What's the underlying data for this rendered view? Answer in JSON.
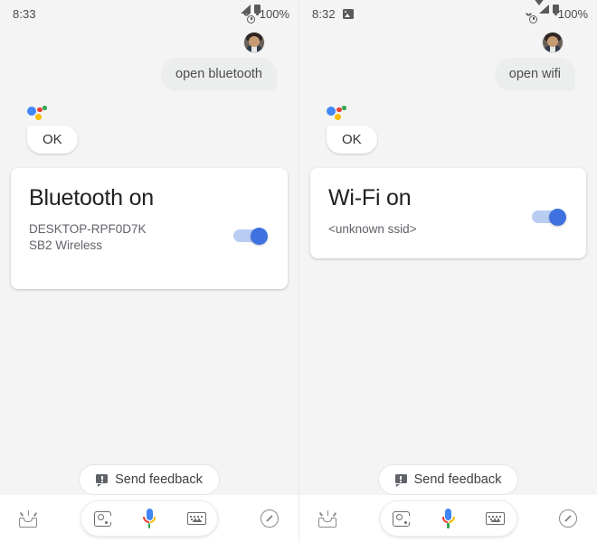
{
  "panels": [
    {
      "status": {
        "time": "8:33",
        "left_icons": [],
        "right_icons": [
          "alarm-icon",
          "signal-icon",
          "battery-icon"
        ],
        "battery_percent": "100%"
      },
      "user_message": "open bluetooth",
      "assistant_reply": "OK",
      "card": {
        "title": "Bluetooth on",
        "subtitle_line1": "DESKTOP-RPF0D7K",
        "subtitle_line2": "SB2 Wireless",
        "toggle_state": "on"
      },
      "feedback_label": "Send feedback",
      "navbar": {
        "snapshot": "snapshot-icon",
        "lens": "lens-icon",
        "mic": "mic-icon",
        "keyboard": "keyboard-icon",
        "explore": "compass-icon"
      }
    },
    {
      "status": {
        "time": "8:32",
        "left_icons": [
          "image-icon"
        ],
        "right_icons": [
          "alarm-icon",
          "wifi-icon",
          "signal-icon",
          "battery-icon"
        ],
        "battery_percent": "100%"
      },
      "user_message": "open wifi",
      "assistant_reply": "OK",
      "card": {
        "title": "Wi-Fi on",
        "subtitle_line1": "<unknown ssid>",
        "subtitle_line2": "",
        "toggle_state": "on"
      },
      "feedback_label": "Send feedback",
      "navbar": {
        "snapshot": "snapshot-icon",
        "lens": "lens-icon",
        "mic": "mic-icon",
        "keyboard": "keyboard-icon",
        "explore": "compass-icon"
      }
    }
  ],
  "colors": {
    "background": "#f4f4f4",
    "card": "#ffffff",
    "bubble": "#eceeee",
    "toggle_track": "#b9cdf3",
    "toggle_thumb": "#3f72e0",
    "google_blue": "#4285f4",
    "google_red": "#ea4335",
    "google_yellow": "#fbbc05",
    "google_green": "#34a853",
    "title_text": "#202124",
    "secondary_text": "#5f6368"
  }
}
